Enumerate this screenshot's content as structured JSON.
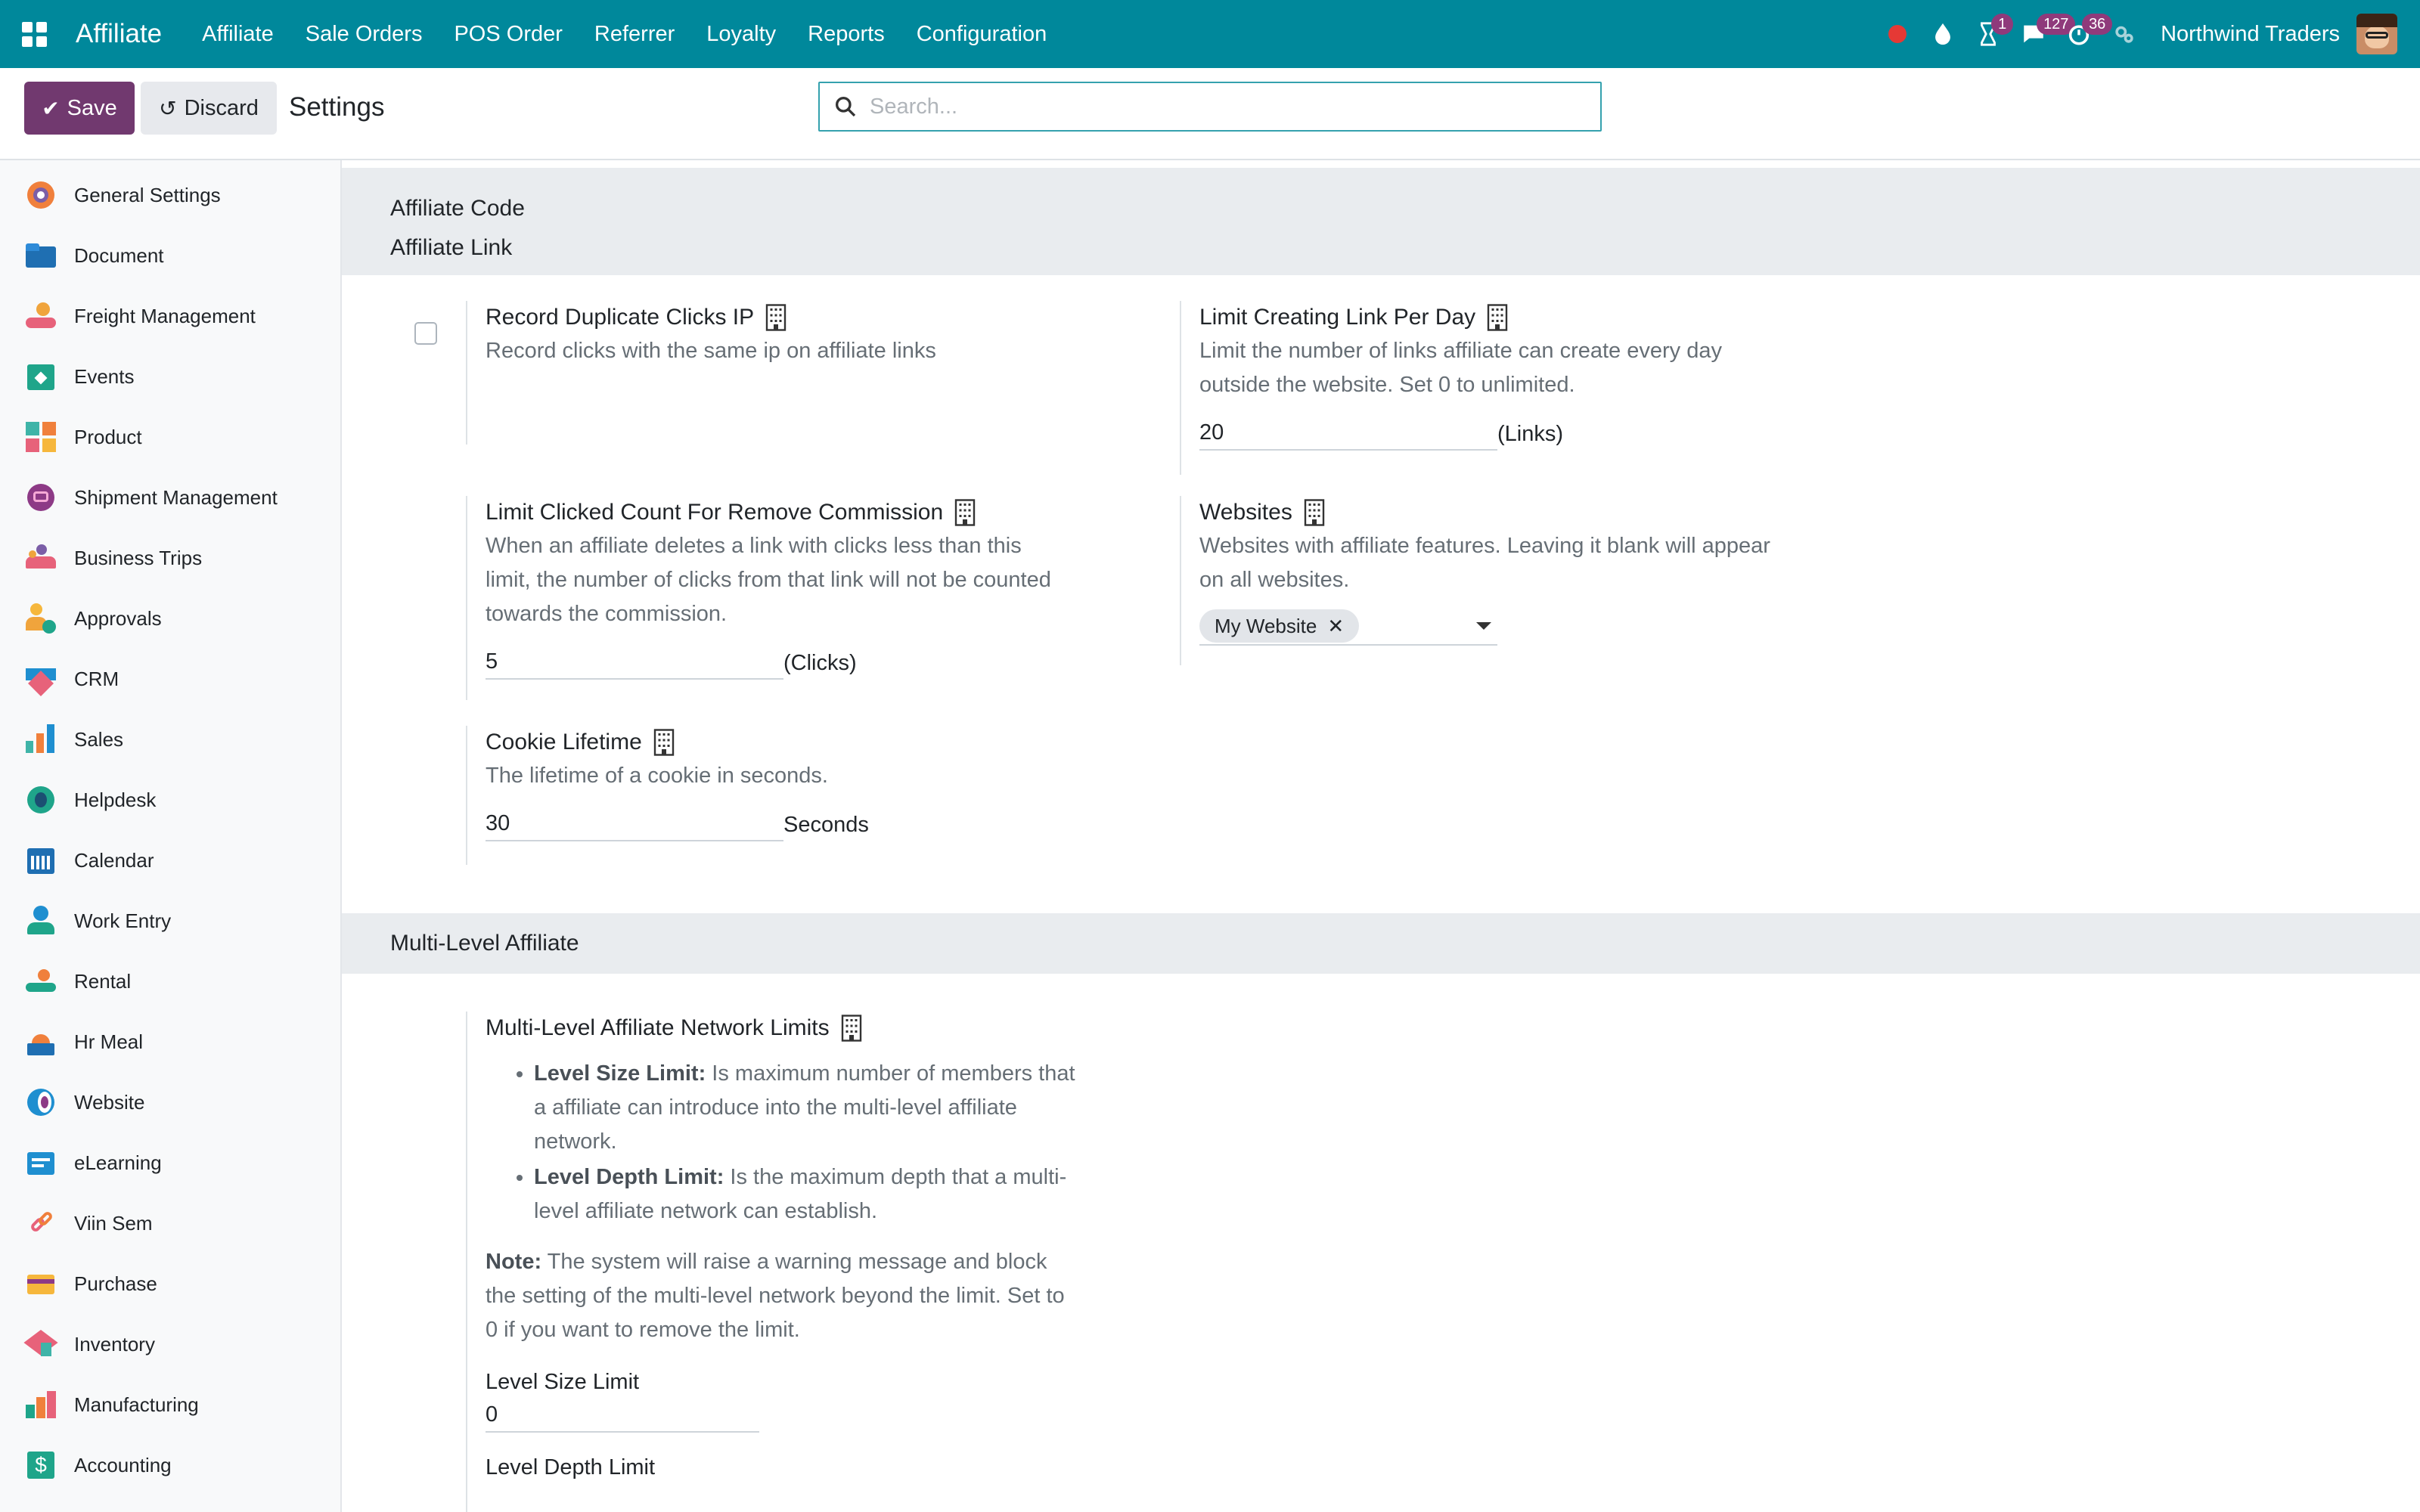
{
  "navbar": {
    "brand": "Affiliate",
    "menu": [
      "Affiliate",
      "Sale Orders",
      "POS Order",
      "Referrer",
      "Loyalty",
      "Reports",
      "Configuration"
    ],
    "badges": {
      "activities": "1",
      "messages": "127",
      "timesheet": "36"
    },
    "company": "Northwind Traders"
  },
  "controls": {
    "save_label": "Save",
    "discard_label": "Discard",
    "breadcrumb": "Settings",
    "search_placeholder": "Search..."
  },
  "sidebar": {
    "items": [
      {
        "label": "General Settings",
        "icon": "general-settings-icon"
      },
      {
        "label": "Document",
        "icon": "document-icon"
      },
      {
        "label": "Freight Management",
        "icon": "freight-icon"
      },
      {
        "label": "Events",
        "icon": "events-icon"
      },
      {
        "label": "Product",
        "icon": "product-icon"
      },
      {
        "label": "Shipment Management",
        "icon": "shipment-icon"
      },
      {
        "label": "Business Trips",
        "icon": "business-trips-icon"
      },
      {
        "label": "Approvals",
        "icon": "approvals-icon"
      },
      {
        "label": "CRM",
        "icon": "crm-icon"
      },
      {
        "label": "Sales",
        "icon": "sales-icon"
      },
      {
        "label": "Helpdesk",
        "icon": "helpdesk-icon"
      },
      {
        "label": "Calendar",
        "icon": "calendar-icon"
      },
      {
        "label": "Work Entry",
        "icon": "work-entry-icon"
      },
      {
        "label": "Rental",
        "icon": "rental-icon"
      },
      {
        "label": "Hr Meal",
        "icon": "hr-meal-icon"
      },
      {
        "label": "Website",
        "icon": "website-icon"
      },
      {
        "label": "eLearning",
        "icon": "elearning-icon"
      },
      {
        "label": "Viin Sem",
        "icon": "viin-sem-icon"
      },
      {
        "label": "Purchase",
        "icon": "purchase-icon"
      },
      {
        "label": "Inventory",
        "icon": "inventory-icon"
      },
      {
        "label": "Manufacturing",
        "icon": "manufacturing-icon"
      },
      {
        "label": "Accounting",
        "icon": "accounting-icon"
      }
    ]
  },
  "section1": {
    "heading_code": "Affiliate Code",
    "heading_link": "Affiliate Link",
    "record_duplicate": {
      "title": "Record Duplicate Clicks IP",
      "desc": "Record clicks with the same ip on affiliate links",
      "checked": false
    },
    "limit_link": {
      "title": "Limit Creating Link Per Day",
      "desc": "Limit the number of links affiliate can create every day outside the website. Set 0 to unlimited.",
      "value": "20",
      "unit": "(Links)"
    },
    "limit_clicked": {
      "title": "Limit Clicked Count For Remove Commission",
      "desc": "When an affiliate deletes a link with clicks less than this limit, the number of clicks from that link will not be counted towards the commission.",
      "value": "5",
      "unit": "(Clicks)"
    },
    "websites": {
      "title": "Websites",
      "desc": "Websites with affiliate features. Leaving it blank will appear on all websites.",
      "tag": "My Website"
    },
    "cookie": {
      "title": "Cookie Lifetime",
      "desc": "The lifetime of a cookie in seconds.",
      "value": "30",
      "unit": "Seconds"
    }
  },
  "section2": {
    "heading": "Multi-Level Affiliate",
    "network_limits": {
      "title": "Multi-Level Affiliate Network Limits",
      "bullet1_bold": "Level Size Limit:",
      "bullet1_text": " Is maximum number of members that a affiliate can introduce into the multi-level affiliate network.",
      "bullet2_bold": "Level Depth Limit:",
      "bullet2_text": " Is the maximum depth that a multi-level affiliate network can establish.",
      "note_bold": "Note:",
      "note_text": " The system will raise a warning message and block the setting of the multi-level network beyond the limit. Set to 0 if you want to remove the limit.",
      "size_label": "Level Size Limit",
      "size_value": "0",
      "depth_label": "Level Depth Limit"
    }
  }
}
